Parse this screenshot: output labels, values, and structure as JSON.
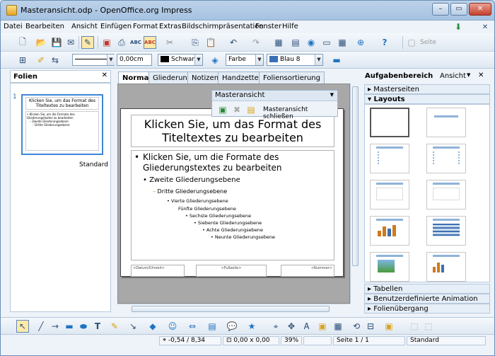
{
  "window": {
    "title": "Masteransicht.odp - OpenOffice.org Impress"
  },
  "menu": [
    "Datei",
    "Bearbeiten",
    "Ansicht",
    "Einfügen",
    "Format",
    "Extras",
    "Bildschirmpräsentation",
    "Fenster",
    "Hilfe"
  ],
  "toolbar2": {
    "line_width": "0,00cm",
    "line_color": "Schwarz",
    "area_type": "Farbe",
    "area_color": "Blau 8",
    "slide_design_label": "Seite"
  },
  "slides_panel": {
    "title": "Folien",
    "slide_number": "1",
    "layout_name": "Standard"
  },
  "thumb": {
    "title": "Klicken Sie, um das Format des Titeltextes zu bearbeiten",
    "body": [
      "• Klicken Sie, um die Formate des Gliederungstextes zu bearbeiten",
      "– Zweite Gliederungsebene",
      "– Dritte Gliederungsebene"
    ]
  },
  "tabs": [
    "Normal",
    "Gliederung",
    "Notizen",
    "Handzettel",
    "Foliensortierung"
  ],
  "master_toolbar": {
    "title": "Masteransicht",
    "close_label": "Masteransicht schließen"
  },
  "slide": {
    "title": "Klicken Sie, um das Format des Titeltextes zu bearbeiten",
    "level1": "Klicken Sie, um die Formate des Gliederungstextes zu bearbeiten",
    "level2": "Zweite Gliederungsebene",
    "level3": "Dritte Gliederungsebene",
    "level4": "Vierte Gliederungsebene",
    "level5": "Fünfte Gliederungsebene",
    "level6": "Sechste Gliederungsebene",
    "level7": "Siebente Gliederungsebene",
    "level8": "Achte Gliederungsebene",
    "level9": "Neunte Gliederungsebene",
    "footer_date": "<Datum/Uhrzeit>",
    "footer_text": "<Fußzeile>",
    "footer_number": "<Nummer>"
  },
  "taskpane": {
    "title": "Aufgabenbereich",
    "view_label": "Ansicht",
    "sections": [
      "Masterseiten",
      "Layouts",
      "Tabellen",
      "Benutzerdefinierte Animation",
      "Folienübergang"
    ]
  },
  "status": {
    "position": "-0,54 / 8,34",
    "size": "0,00 x 0,00",
    "zoom": "39%",
    "slide": "Seite 1 / 1",
    "layout": "Standard"
  },
  "colors": {
    "accent": "#3e86d6",
    "titlebar": "#bcd2ea",
    "workspace": "#a8a8a8"
  },
  "icons": [
    "new-icon",
    "open-icon",
    "save-icon",
    "print-icon",
    "spellcheck-icon",
    "undo-icon",
    "redo-icon",
    "help-icon",
    "select-icon",
    "line-icon",
    "rectangle-icon",
    "ellipse-icon",
    "text-icon"
  ]
}
